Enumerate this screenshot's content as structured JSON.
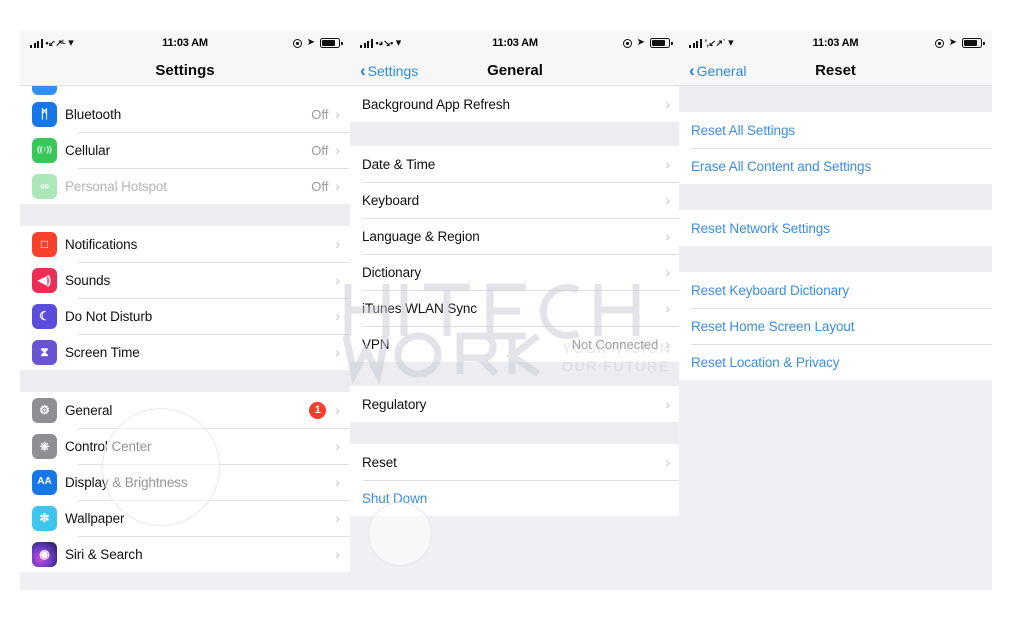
{
  "meta": {
    "watermark": {
      "brand_line1": "HITECH",
      "brand_line2": "WORK",
      "tagline1": "YOUR VISION",
      "tagline2": "OUR FUTURE",
      "color": "#c9ccd3"
    },
    "accent_blue": "#3c8ddc",
    "badge_red": "#f93d2c",
    "group_bg": "#ececf1"
  },
  "panels": [
    {
      "id": "settings",
      "statusbar": {
        "time": "11:03 AM",
        "signal_icon": "signal-bars-icon",
        "carrier_glyph": "carrier-icon",
        "wifi_icon": "wifi-icon",
        "dnd_icon": "do-not-disturb-icon",
        "location_icon": "location-arrow-icon",
        "battery_icon": "battery-icon"
      },
      "nav": {
        "title": "Settings",
        "back": ""
      },
      "sections": [
        {
          "rows": [
            {
              "label": "Bluetooth",
              "value": "Off",
              "icon": "bluetooth-icon",
              "icon_glyph": "ᛗ",
              "icon_color": "#1677e8",
              "chevron": true
            },
            {
              "label": "Cellular",
              "value": "Off",
              "icon": "cellular-icon",
              "icon_glyph": "((↑))",
              "icon_color": "#39c75a",
              "chevron": true
            },
            {
              "label": "Personal Hotspot",
              "value": "Off",
              "icon": "personal-hotspot-icon",
              "icon_glyph": "∞",
              "icon_color": "#39c75a",
              "chevron": true,
              "dim": true
            }
          ]
        },
        {
          "rows": [
            {
              "label": "Notifications",
              "value": "",
              "icon": "notifications-icon",
              "icon_glyph": "□",
              "icon_color": "#f8402b",
              "chevron": true
            },
            {
              "label": "Sounds",
              "value": "",
              "icon": "sounds-icon",
              "icon_glyph": "◀)",
              "icon_color": "#ef2e55",
              "chevron": true
            },
            {
              "label": "Do Not Disturb",
              "value": "",
              "icon": "do-not-disturb-icon",
              "icon_glyph": "☾",
              "icon_color": "#5a4ddb",
              "chevron": true
            },
            {
              "label": "Screen Time",
              "value": "",
              "icon": "screen-time-icon",
              "icon_glyph": "⧗",
              "icon_color": "#6b54d3",
              "chevron": true
            }
          ]
        },
        {
          "rows": [
            {
              "label": "General",
              "value": "",
              "icon": "general-gear-icon",
              "icon_glyph": "⚙",
              "icon_color": "#8e8e93",
              "chevron": true,
              "badge": "1"
            },
            {
              "label": "Control Center",
              "value": "",
              "icon": "control-center-icon",
              "icon_glyph": "⎈",
              "icon_color": "#8e8e93",
              "chevron": true
            },
            {
              "label": "Display & Brightness",
              "value": "",
              "icon": "display-brightness-icon",
              "icon_glyph": "AA",
              "icon_color": "#1677e8",
              "chevron": true
            },
            {
              "label": "Wallpaper",
              "value": "",
              "icon": "wallpaper-icon",
              "icon_glyph": "✻",
              "icon_color": "#3ec6ee",
              "chevron": true
            },
            {
              "label": "Siri & Search",
              "value": "",
              "icon": "siri-search-icon",
              "icon_glyph": "◉",
              "icon_color": "#2b1f4e",
              "chevron": true
            }
          ]
        }
      ]
    },
    {
      "id": "general",
      "statusbar": {
        "time": "11:03 AM",
        "signal_icon": "signal-bars-icon",
        "carrier_glyph": "carrier-icon",
        "wifi_icon": "wifi-icon",
        "dnd_icon": "do-not-disturb-icon",
        "location_icon": "location-arrow-icon",
        "battery_icon": "battery-icon"
      },
      "nav": {
        "title": "General",
        "back": "Settings"
      },
      "sections": [
        {
          "rows": [
            {
              "label": "Background App Refresh",
              "value": "",
              "chevron": true
            }
          ]
        },
        {
          "rows": [
            {
              "label": "Date & Time",
              "value": "",
              "chevron": true
            },
            {
              "label": "Keyboard",
              "value": "",
              "chevron": true
            },
            {
              "label": "Language & Region",
              "value": "",
              "chevron": true
            },
            {
              "label": "Dictionary",
              "value": "",
              "chevron": true
            },
            {
              "label": "iTunes WLAN Sync",
              "value": "",
              "chevron": true
            },
            {
              "label": "VPN",
              "value": "Not Connected",
              "chevron": true
            }
          ]
        },
        {
          "rows": [
            {
              "label": "Regulatory",
              "value": "",
              "chevron": true
            }
          ]
        },
        {
          "rows": [
            {
              "label": "Reset",
              "value": "",
              "chevron": true
            },
            {
              "label": "Shut Down",
              "value": "",
              "chevron": false,
              "link": true
            }
          ]
        }
      ]
    },
    {
      "id": "reset",
      "statusbar": {
        "time": "11:03 AM",
        "signal_icon": "signal-bars-icon",
        "carrier_glyph": "carrier-icon",
        "wifi_icon": "wifi-icon",
        "dnd_icon": "do-not-disturb-icon",
        "location_icon": "location-arrow-icon",
        "battery_icon": "battery-icon"
      },
      "nav": {
        "title": "Reset",
        "back": "General"
      },
      "sections": [
        {
          "rows": [
            {
              "label": "Reset All Settings",
              "value": "",
              "chevron": false,
              "link": true
            },
            {
              "label": "Erase All Content and Settings",
              "value": "",
              "chevron": false,
              "link": true
            }
          ]
        },
        {
          "rows": [
            {
              "label": "Reset Network Settings",
              "value": "",
              "chevron": false,
              "link": true
            }
          ]
        },
        {
          "rows": [
            {
              "label": "Reset Keyboard Dictionary",
              "value": "",
              "chevron": false,
              "link": true
            },
            {
              "label": "Reset Home Screen Layout",
              "value": "",
              "chevron": false,
              "link": true
            },
            {
              "label": "Reset Location & Privacy",
              "value": "",
              "chevron": false,
              "link": true
            }
          ]
        }
      ]
    }
  ]
}
